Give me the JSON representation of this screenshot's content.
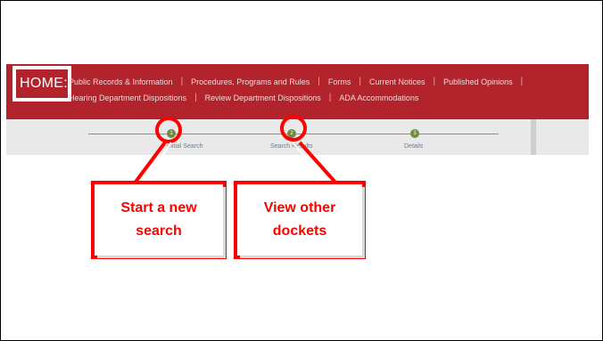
{
  "nav": {
    "home_label": "HOME:",
    "row1": [
      "Public Records & Information",
      "Procedures, Programs and Rules",
      "Forms",
      "Current Notices",
      "Published Opinions"
    ],
    "row2": [
      "Hearing Department Dispositions",
      "Review Department Dispositions",
      "ADA Accommodations"
    ],
    "separator": "|"
  },
  "steps": [
    {
      "number": "1",
      "label": "Initial Search"
    },
    {
      "number": "2",
      "label": "Search Results"
    },
    {
      "number": "3",
      "label": "Details"
    }
  ],
  "callouts": {
    "new_search": {
      "line1": "Start a new",
      "line2": "search"
    },
    "other_dockets": {
      "line1": "View other",
      "line2": "dockets"
    }
  },
  "colors": {
    "nav_bg": "#b3232b",
    "step_green": "#6f8d3c",
    "annotation_red": "#ff0000"
  }
}
